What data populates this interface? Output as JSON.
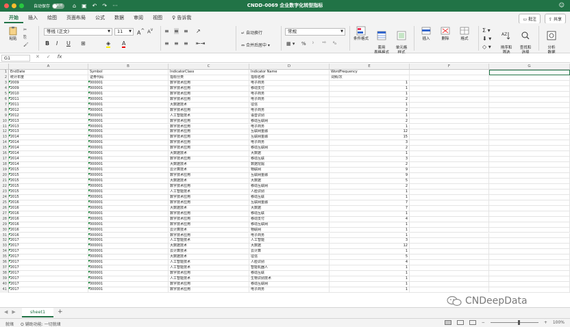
{
  "window": {
    "autosave_label": "自动保存",
    "autosave_state": "关闭",
    "title": "CNDD-0069 企业数字化转型指标"
  },
  "ribbon_tabs": [
    "开始",
    "插入",
    "绘图",
    "页面布局",
    "公式",
    "数据",
    "审阅",
    "视图"
  ],
  "tell_me": "告诉我",
  "comments_label": "批注",
  "share_label": "共享",
  "ribbon": {
    "paste": "粘贴",
    "font_name": "等线 (正文)",
    "font_size": "11",
    "wrap_text": "自动换行",
    "merge_center": "合并后居中",
    "number_format": "常规",
    "percent": "%",
    "conditional_format": "条件格式",
    "format_as_table": "套用\n表格格式",
    "cell_styles": "单元格\n样式",
    "insert": "插入",
    "delete": "删除",
    "format": "格式",
    "sort_filter": "排序和\n筛选",
    "find_select": "查找和\n选择",
    "analyze_data": "分析\n数据"
  },
  "formula_bar": {
    "name_box": "G1",
    "fx": "fx"
  },
  "columns": [
    "A",
    "B",
    "C",
    "D",
    "E",
    "F",
    "G"
  ],
  "headers_row1": [
    "EndDate",
    "Symbol",
    "IndicatorClass",
    "Indicator Name",
    "WordFrequency"
  ],
  "headers_row2": [
    "统计年度",
    "证券代码",
    "指标分类",
    "指标名称",
    "词频/次"
  ],
  "rows": [
    [
      "2009",
      "000001",
      "数字技术应用",
      "电子商务",
      "1"
    ],
    [
      "2009",
      "000001",
      "数字技术应用",
      "移动支付",
      "1"
    ],
    [
      "2010",
      "000001",
      "数字技术应用",
      "电子商务",
      "1"
    ],
    [
      "2011",
      "000001",
      "数字技术应用",
      "电子商务",
      "2"
    ],
    [
      "2011",
      "000001",
      "大数据技术",
      "征信",
      "1"
    ],
    [
      "2012",
      "000001",
      "数字技术应用",
      "电子商务",
      "2"
    ],
    [
      "2012",
      "000001",
      "人工智能技术",
      "语音识别",
      "1"
    ],
    [
      "2013",
      "000001",
      "数字技术应用",
      "移动互联网",
      "2"
    ],
    [
      "2013",
      "000001",
      "数字技术应用",
      "电子商务",
      "1"
    ],
    [
      "2013",
      "000001",
      "数字技术应用",
      "互联网金融",
      "12"
    ],
    [
      "2014",
      "000001",
      "数字技术应用",
      "互联网金融",
      "15"
    ],
    [
      "2014",
      "000001",
      "数字技术应用",
      "电子商务",
      "3"
    ],
    [
      "2014",
      "000001",
      "数字技术应用",
      "移动互联网",
      "2"
    ],
    [
      "2014",
      "000001",
      "大数据技术",
      "大数据",
      "1"
    ],
    [
      "2014",
      "000001",
      "数字技术应用",
      "移动互联",
      "3"
    ],
    [
      "2014",
      "000001",
      "大数据技术",
      "数据挖掘",
      "2"
    ],
    [
      "2015",
      "000001",
      "云计算技术",
      "物联网",
      "9"
    ],
    [
      "2015",
      "000001",
      "数字技术应用",
      "互联网金融",
      "9"
    ],
    [
      "2015",
      "000001",
      "大数据技术",
      "大数据",
      "5"
    ],
    [
      "2015",
      "000001",
      "数字技术应用",
      "移动互联网",
      "2"
    ],
    [
      "2015",
      "000001",
      "人工智能技术",
      "人脸识别",
      "1"
    ],
    [
      "2015",
      "000001",
      "数字技术应用",
      "移动互联",
      "1"
    ],
    [
      "2016",
      "000001",
      "数字技术应用",
      "互联网金融",
      "7"
    ],
    [
      "2016",
      "000001",
      "大数据技术",
      "大数据",
      "7"
    ],
    [
      "2016",
      "000001",
      "数字技术应用",
      "移动互联",
      "1"
    ],
    [
      "2016",
      "000001",
      "数字技术应用",
      "移动支付",
      "4"
    ],
    [
      "2016",
      "000001",
      "数字技术应用",
      "移动互联网",
      "1"
    ],
    [
      "2016",
      "000001",
      "云计算技术",
      "物联网",
      "1"
    ],
    [
      "2016",
      "000001",
      "数字技术应用",
      "电子商务",
      "1"
    ],
    [
      "2017",
      "000001",
      "人工智能技术",
      "人工智能",
      "3"
    ],
    [
      "2017",
      "000001",
      "大数据技术",
      "大数据",
      "12"
    ],
    [
      "2017",
      "000001",
      "云计算技术",
      "云计算",
      "1"
    ],
    [
      "2017",
      "000001",
      "大数据技术",
      "征信",
      "5"
    ],
    [
      "2017",
      "000001",
      "人工智能技术",
      "人脸识别",
      "4"
    ],
    [
      "2017",
      "000001",
      "人工智能技术",
      "智能机器人",
      "1"
    ],
    [
      "2017",
      "000001",
      "数字技术应用",
      "移动互联",
      "1"
    ],
    [
      "2017",
      "000001",
      "人工智能技术",
      "生物识别技术",
      "1"
    ],
    [
      "2017",
      "000001",
      "数字技术应用",
      "移动互联网",
      "1"
    ],
    [
      "2017",
      "000001",
      "数字技术应用",
      "电子商务",
      "1"
    ]
  ],
  "watermark": "CNDeepData",
  "sheet_tab": "sheet1",
  "status": {
    "ready": "就绪",
    "accessibility": "辅助功能: 一切就绪",
    "zoom": "100%"
  }
}
